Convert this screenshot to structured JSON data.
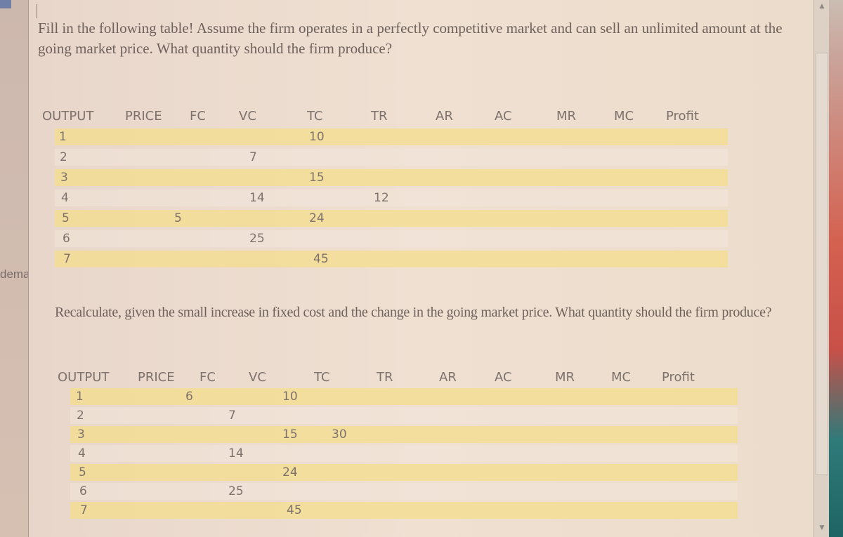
{
  "side_word": "dema",
  "prompt1": "Fill in the following table! Assume the firm operates in a perfectly competitive market and can sell an unlimited amount at the going market price. What quantity should the firm produce?",
  "prompt2": "Recalculate, given the small increase in fixed cost and the change in the going market price. What quantity should the firm produce?",
  "headers": [
    "OUTPUT",
    "PRICE",
    "FC",
    "VC",
    "TC",
    "TR",
    "AR",
    "AC",
    "MR",
    "MC",
    "Profit"
  ],
  "table1": {
    "rows": [
      {
        "output": "1",
        "price": "",
        "fc": "",
        "vc": "",
        "tc": "10",
        "tr": ""
      },
      {
        "output": "2",
        "price": "",
        "fc": "",
        "vc": "7",
        "tc": "",
        "tr": ""
      },
      {
        "output": "3",
        "price": "",
        "fc": "",
        "vc": "",
        "tc": "15",
        "tr": ""
      },
      {
        "output": "4",
        "price": "",
        "fc": "",
        "vc": "14",
        "tc": "",
        "tr": "12"
      },
      {
        "output": "5",
        "price": "",
        "fc": "5",
        "vc": "",
        "tc": "24",
        "tr": ""
      },
      {
        "output": "6",
        "price": "",
        "fc": "",
        "vc": "25",
        "tc": "",
        "tr": ""
      },
      {
        "output": "7",
        "price": "",
        "fc": "",
        "vc": "",
        "tc": "45",
        "tr": ""
      }
    ]
  },
  "table2": {
    "rows": [
      {
        "output": "1",
        "price": "",
        "fc": "6",
        "vc": "",
        "tc": "10",
        "tr": ""
      },
      {
        "output": "2",
        "price": "",
        "fc": "",
        "vc": "7",
        "tc": "",
        "tr": ""
      },
      {
        "output": "3",
        "price": "",
        "fc": "",
        "vc": "",
        "tc": "15",
        "tr": "30"
      },
      {
        "output": "4",
        "price": "",
        "fc": "",
        "vc": "14",
        "tc": "",
        "tr": ""
      },
      {
        "output": "5",
        "price": "",
        "fc": "",
        "vc": "",
        "tc": "24",
        "tr": ""
      },
      {
        "output": "6",
        "price": "",
        "fc": "",
        "vc": "25",
        "tc": "",
        "tr": ""
      },
      {
        "output": "7",
        "price": "",
        "fc": "",
        "vc": "",
        "tc": "45",
        "tr": ""
      }
    ]
  },
  "scrollbar": {
    "up_icon": "▲",
    "down_icon": "▼"
  }
}
